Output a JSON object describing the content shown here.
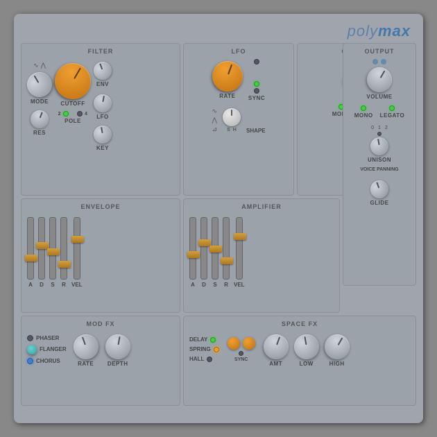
{
  "brand": {
    "prefix": "poly",
    "suffix": "max"
  },
  "filter": {
    "label": "FILTER",
    "knobs": {
      "mode_label": "MODE",
      "res_label": "RES",
      "cutoff_label": "CUTOFF",
      "env_label": "ENV",
      "lfo_label": "LFO",
      "key_label": "KEY"
    },
    "pole_label": "POLE",
    "pole_options": [
      "2",
      "4"
    ]
  },
  "lfo": {
    "label": "LFO",
    "rate_label": "RATE",
    "sync_label": "SYNC",
    "shape_label": "SHAPE"
  },
  "output": {
    "label": "OUTPUT",
    "volume_label": "VOLUME",
    "mono_label": "MONO",
    "legato_label": "LEGATO",
    "unison_label": "UNISON",
    "voice_panning_label": "VOICE PANNING",
    "glide_label": "GLIDE",
    "unison_values": [
      "0",
      "1",
      "2"
    ]
  },
  "envelope": {
    "label": "ENVELOPE",
    "sliders": [
      "A",
      "D",
      "S",
      "R",
      "VEL"
    ]
  },
  "amplifier": {
    "label": "AMPLIFIER",
    "sliders": [
      "A",
      "D",
      "S",
      "R",
      "VEL"
    ]
  },
  "modfx": {
    "label": "MOD FX",
    "types": [
      "PHASER",
      "FLANGER",
      "CHORUS"
    ],
    "rate_label": "RATE",
    "depth_label": "DEPTH"
  },
  "spacefx": {
    "label": "SPACE FX",
    "types": [
      "DELAY",
      "SPRING",
      "HALL"
    ],
    "sync_label": "SYNC",
    "amt_label": "AMT",
    "low_label": "LOW",
    "high_label": "HIGH"
  }
}
